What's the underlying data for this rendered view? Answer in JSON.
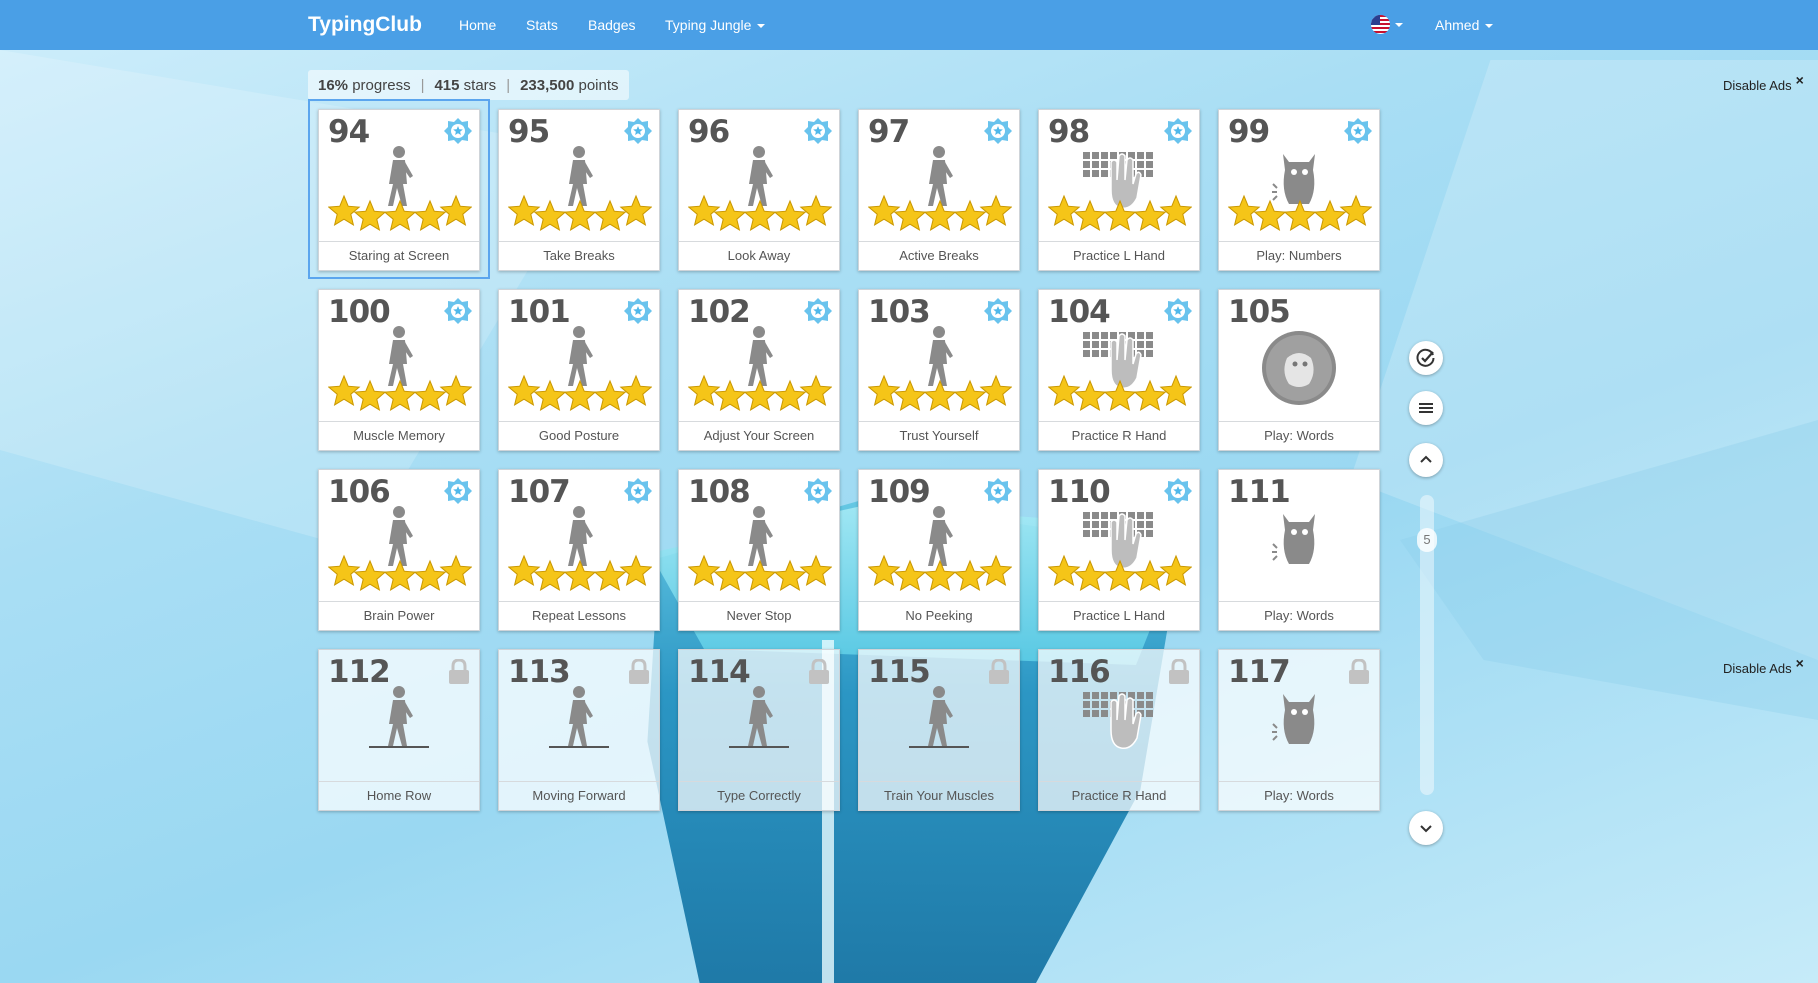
{
  "header": {
    "brand": "TypingClub",
    "nav": [
      {
        "label": "Home"
      },
      {
        "label": "Stats"
      },
      {
        "label": "Badges"
      },
      {
        "label": "Typing Jungle"
      }
    ],
    "user": "Ahmed"
  },
  "stats": {
    "progress_value": "16%",
    "progress_label": "progress",
    "stars_value": "415",
    "stars_label": "stars",
    "points_value": "233,500",
    "points_label": "points"
  },
  "ads": {
    "label": "Disable Ads",
    "close": "×"
  },
  "scroll": {
    "page": "5"
  },
  "lessons": [
    {
      "num": "94",
      "title": "Staring at Screen",
      "icon": "walker-icon",
      "stars": 5,
      "locked": false,
      "selected": true
    },
    {
      "num": "95",
      "title": "Take Breaks",
      "icon": "walker-icon",
      "stars": 5,
      "locked": false
    },
    {
      "num": "96",
      "title": "Look Away",
      "icon": "walker-icon",
      "stars": 5,
      "locked": false
    },
    {
      "num": "97",
      "title": "Active Breaks",
      "icon": "walker-icon",
      "stars": 5,
      "locked": false
    },
    {
      "num": "98",
      "title": "Practice L Hand",
      "icon": "keyboard-hand-icon",
      "stars": 5,
      "locked": false
    },
    {
      "num": "99",
      "title": "Play: Numbers",
      "icon": "monster-icon",
      "stars": 5,
      "locked": false
    },
    {
      "num": "100",
      "title": "Muscle Memory",
      "icon": "walker-icon",
      "stars": 5,
      "locked": false
    },
    {
      "num": "101",
      "title": "Good Posture",
      "icon": "walker-icon",
      "stars": 5,
      "locked": false
    },
    {
      "num": "102",
      "title": "Adjust Your Screen",
      "icon": "walker-icon",
      "stars": 5,
      "locked": false
    },
    {
      "num": "103",
      "title": "Trust Yourself",
      "icon": "walker-icon",
      "stars": 5,
      "locked": false
    },
    {
      "num": "104",
      "title": "Practice R Hand",
      "icon": "keyboard-hand-icon",
      "stars": 5,
      "locked": false
    },
    {
      "num": "105",
      "title": "Play: Words",
      "icon": "monster-circle-icon",
      "stars": 0,
      "locked": false
    },
    {
      "num": "106",
      "title": "Brain Power",
      "icon": "walker-icon",
      "stars": 5,
      "locked": false
    },
    {
      "num": "107",
      "title": "Repeat Lessons",
      "icon": "walker-icon",
      "stars": 5,
      "locked": false
    },
    {
      "num": "108",
      "title": "Never Stop",
      "icon": "walker-icon",
      "stars": 5,
      "locked": false
    },
    {
      "num": "109",
      "title": "No Peeking",
      "icon": "walker-icon",
      "stars": 5,
      "locked": false
    },
    {
      "num": "110",
      "title": "Practice L Hand",
      "icon": "keyboard-hand-icon",
      "stars": 5,
      "locked": false
    },
    {
      "num": "111",
      "title": "Play: Words",
      "icon": "monster-icon",
      "stars": 0,
      "locked": false
    },
    {
      "num": "112",
      "title": "Home Row",
      "icon": "walker-icon",
      "stars": 0,
      "locked": true
    },
    {
      "num": "113",
      "title": "Moving Forward",
      "icon": "walker-icon",
      "stars": 0,
      "locked": true
    },
    {
      "num": "114",
      "title": "Type Correctly",
      "icon": "walker-icon",
      "stars": 0,
      "locked": true
    },
    {
      "num": "115",
      "title": "Train Your Muscles",
      "icon": "walker-icon",
      "stars": 0,
      "locked": true
    },
    {
      "num": "116",
      "title": "Practice R Hand",
      "icon": "keyboard-hand-icon",
      "stars": 0,
      "locked": true
    },
    {
      "num": "117",
      "title": "Play: Words",
      "icon": "monster-icon",
      "stars": 0,
      "locked": true
    }
  ],
  "colors": {
    "navbar": "#4a9fe6",
    "star": "#f5c518",
    "badge": "#4fb8ea",
    "icon_gray": "#8a8a8a"
  }
}
